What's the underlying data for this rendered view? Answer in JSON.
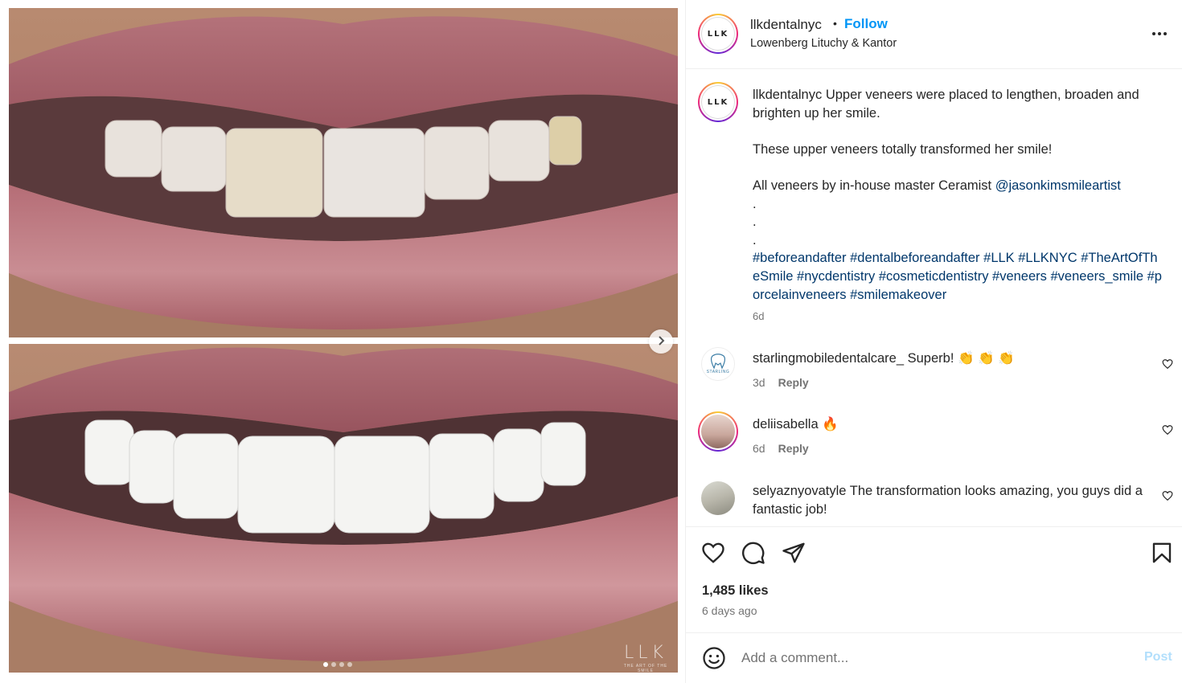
{
  "post": {
    "username": "llkdentalnyc",
    "separator": "•",
    "follow_label": "Follow",
    "location": "Lowenberg Lituchy & Kantor",
    "avatar_logo": "LLK",
    "more_icon": "more-horizontal-icon"
  },
  "media": {
    "watermark_logo": "LLK",
    "watermark_tagline": "THE ART OF THE SMILE",
    "slide_count": 4,
    "active_slide": 1,
    "next_icon": "chevron-right-icon"
  },
  "caption": {
    "username": "llkdentalnyc",
    "line1": "Upper veneers were placed to lengthen, broaden and brighten up her smile.",
    "line2": "These upper veneers totally transformed her smile!",
    "line3_prefix": "All veneers by in-house master Ceramist",
    "mention": "@jasonkimsmileartist",
    "dots": [
      ".",
      ".",
      "."
    ],
    "hashtags": "#beforeandafter #dentalbeforeandafter #LLK #LLKNYC #TheArtOfTheSmile #nycdentistry #cosmeticdentistry #veneers #veneers_smile #porcelainveneers #smilemakeover",
    "time": "6d"
  },
  "comments": [
    {
      "username": "starlingmobiledentalcare_",
      "text": "Superb! 👏 👏 👏",
      "time": "3d",
      "reply_label": "Reply",
      "avatar_label": "STARLING"
    },
    {
      "username": "deliisabella",
      "text": "🔥",
      "time": "6d",
      "reply_label": "Reply"
    },
    {
      "username": "selyaznyovatyle",
      "text": "The transformation looks amazing, you guys did a fantastic job!"
    }
  ],
  "actions": {
    "likes": "1,485 likes",
    "time_ago": "6 days ago",
    "icons": [
      "heart-icon",
      "comment-icon",
      "share-icon",
      "bookmark-icon"
    ]
  },
  "add_comment": {
    "placeholder": "Add a comment...",
    "post_label": "Post",
    "emoji_icon": "emoji-icon"
  }
}
